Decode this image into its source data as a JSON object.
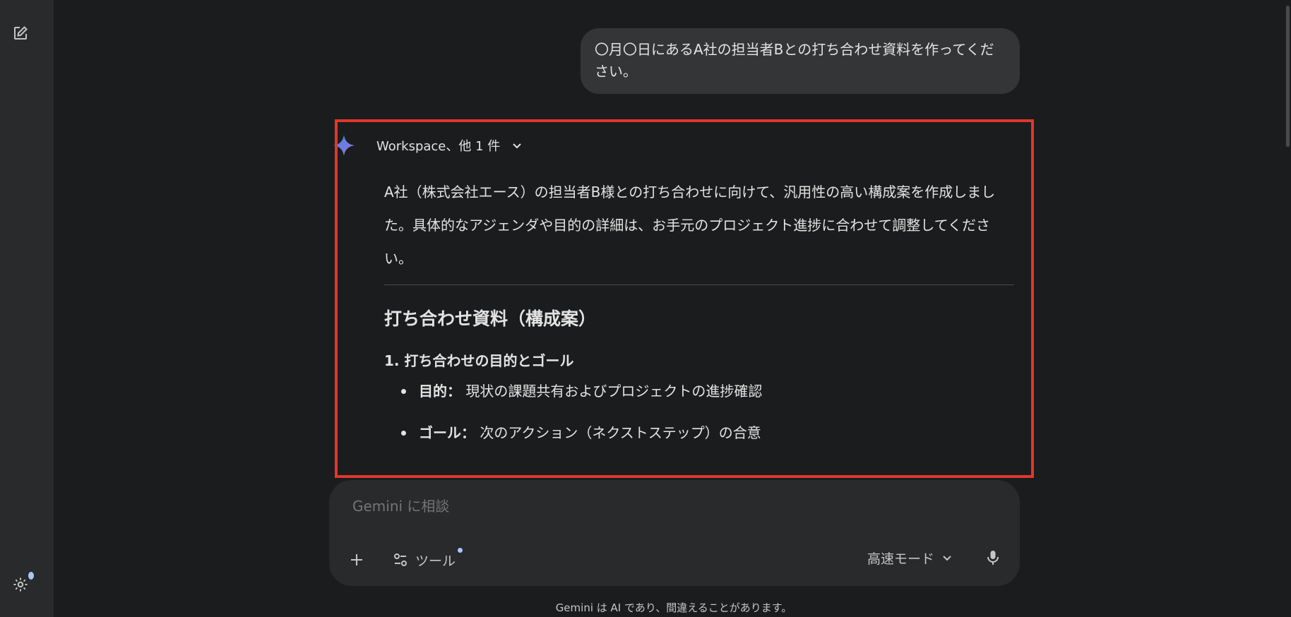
{
  "sidebar": {
    "new_chat_icon": "edit-square-icon",
    "settings_icon": "gear-icon"
  },
  "user_message": {
    "text": "〇月〇日にあるA社の担当者Bとの打ち合わせ資料を作ってください。"
  },
  "response": {
    "tools_label": "Workspace、他 1 件",
    "intro": "A社（株式会社エース）の担当者B様との打ち合わせに向けて、汎用性の高い構成案を作成しました。具体的なアジェンダや目的の詳細は、お手元のプロジェクト進捗に合わせて調整してください。",
    "heading": "打ち合わせ資料（構成案）",
    "section_title": "1. 打ち合わせの目的とゴール",
    "bullets": [
      {
        "term": "目的：",
        "text": " 現状の課題共有およびプロジェクトの進捗確認"
      },
      {
        "term": "ゴール：",
        "text": " 次のアクション（ネクストステップ）の合意"
      }
    ]
  },
  "composer": {
    "placeholder": "Gemini に相談",
    "tools_label": "ツール",
    "mode_label": "高速モード"
  },
  "footer": {
    "disclaimer": "Gemini は AI であり、間違えることがあります。"
  },
  "colors": {
    "background": "#1b1c1d",
    "rail": "#282a2c",
    "highlight_frame": "#e0372b",
    "accent": "#a8c7fa"
  }
}
